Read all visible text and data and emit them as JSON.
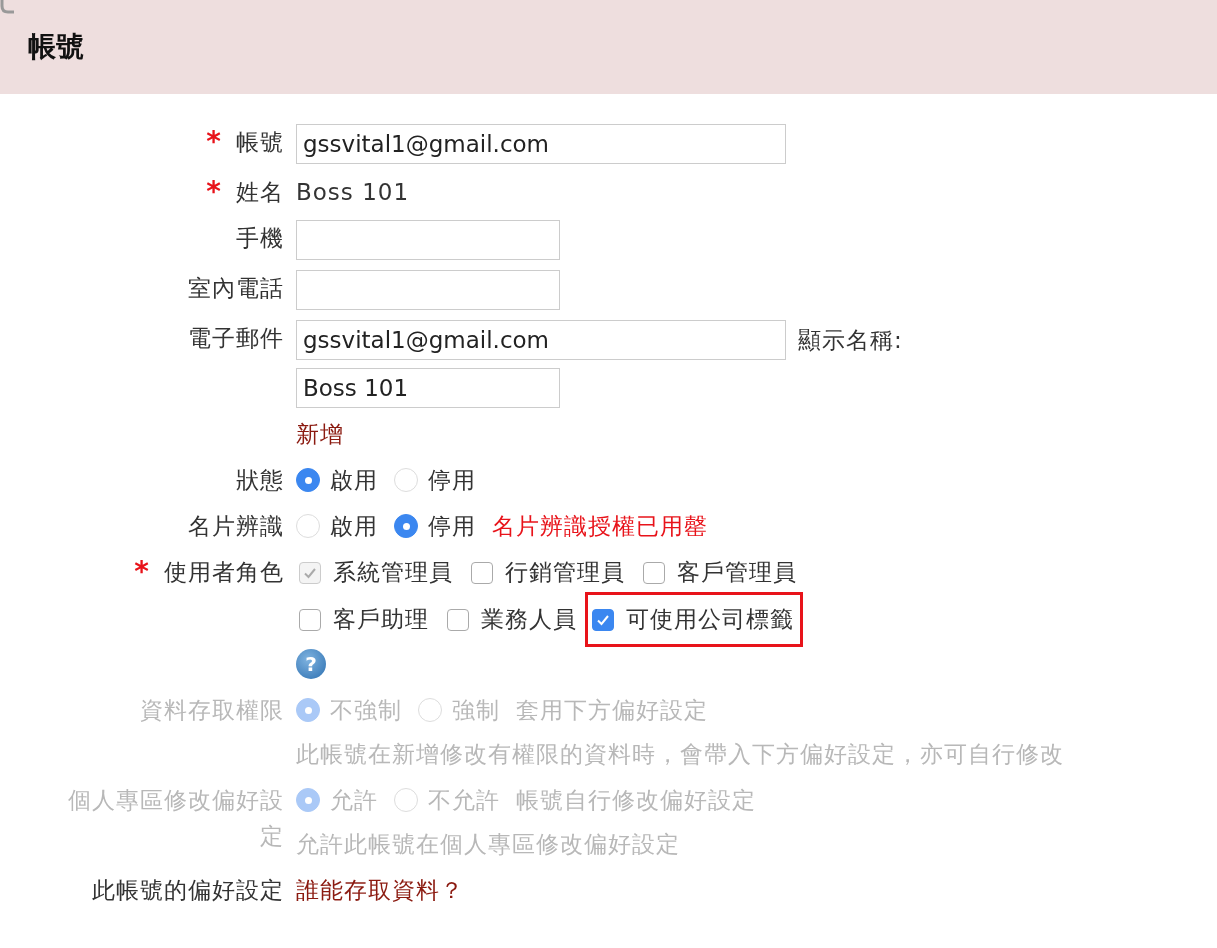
{
  "header": {
    "title": "帳號"
  },
  "required_mark": "*",
  "rows": [
    {
      "kind": "wide-input",
      "label": "帳號",
      "required": true,
      "value": "gssvital1@gmail.com"
    },
    {
      "kind": "static",
      "label": "姓名",
      "required": true,
      "value": "Boss 101"
    },
    {
      "kind": "input",
      "label": "手機",
      "required": false,
      "value": ""
    },
    {
      "kind": "input",
      "label": "室內電話",
      "required": false,
      "value": ""
    },
    {
      "kind": "email",
      "label": "電子郵件",
      "required": false,
      "value": "gssvital1@gmail.com",
      "side_label": "顯示名稱:",
      "display_name": "Boss 101",
      "link": "新增"
    },
    {
      "kind": "radios",
      "label": "狀態",
      "required": false,
      "disabled": false,
      "options": [
        {
          "label": "啟用",
          "selected": true
        },
        {
          "label": "停用",
          "selected": false
        }
      ]
    },
    {
      "kind": "radios",
      "label": "名片辨識",
      "required": false,
      "disabled": false,
      "options": [
        {
          "label": "啟用",
          "selected": false
        },
        {
          "label": "停用",
          "selected": true
        }
      ],
      "note": "名片辨識授權已用罄"
    },
    {
      "kind": "checkboxes",
      "label": "使用者角色",
      "required": true,
      "options": [
        {
          "label": "系統管理員",
          "checked": true,
          "disabled": true
        },
        {
          "label": "行銷管理員",
          "checked": false,
          "disabled": false
        },
        {
          "label": "客戶管理員",
          "checked": false,
          "disabled": false
        },
        {
          "label": "客戶助理",
          "checked": false,
          "disabled": false
        },
        {
          "label": "業務人員",
          "checked": false,
          "disabled": false
        },
        {
          "label": "可使用公司標籤",
          "checked": true,
          "disabled": false,
          "highlighted": true
        }
      ],
      "help": "?"
    },
    {
      "kind": "radios",
      "label": "資料存取權限",
      "required": false,
      "disabled": true,
      "options": [
        {
          "label": "不強制",
          "selected": true
        },
        {
          "label": "強制",
          "selected": false
        }
      ],
      "suffix": "套用下方偏好設定",
      "hint": "此帳號在新增修改有權限的資料時，會帶入下方偏好設定，亦可自行修改"
    },
    {
      "kind": "radios",
      "label": "個人專區修改偏好設定",
      "required": false,
      "disabled": true,
      "options": [
        {
          "label": "允許",
          "selected": true
        },
        {
          "label": "不允許",
          "selected": false
        }
      ],
      "suffix": "帳號自行修改偏好設定",
      "hint": "允許此帳號在個人專區修改偏好設定"
    },
    {
      "kind": "link",
      "label": "此帳號的偏好設定",
      "required": false,
      "link": "誰能存取資料？"
    }
  ]
}
